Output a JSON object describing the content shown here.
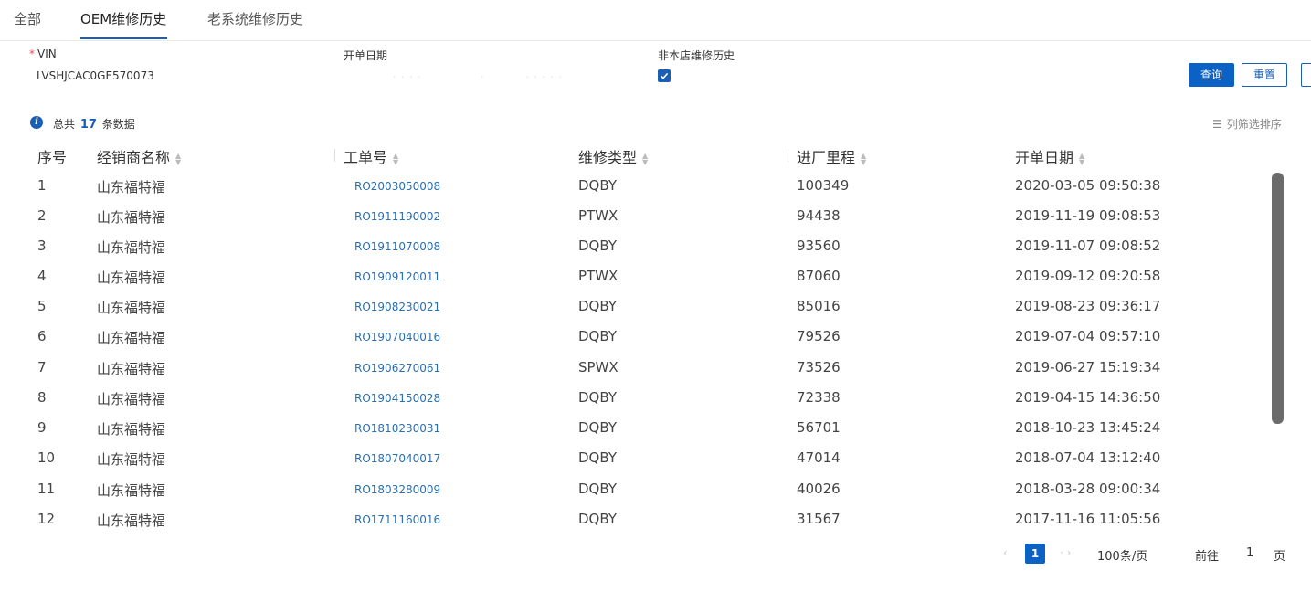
{
  "tabs": [
    {
      "label": "全部"
    },
    {
      "label": "OEM维修历史"
    },
    {
      "label": "老系统维修历史"
    }
  ],
  "form": {
    "vin_label": "VIN",
    "vin_value": "LVSHJCAC0GE570073",
    "date_label": "开单日期",
    "non_store_label": "非本店维修历史",
    "non_store_checked": true
  },
  "buttons": {
    "query": "查询",
    "reset": "重置"
  },
  "summary": {
    "prefix": "总共",
    "count": "17",
    "suffix": "条数据",
    "sort_link": "列筛选排序"
  },
  "table": {
    "headers": [
      "序号",
      "经销商名称",
      "工单号",
      "维修类型",
      "进厂里程",
      "开单日期"
    ],
    "rows": [
      {
        "no": "1",
        "dealer": "山东福特福",
        "ro": "RO2003050008",
        "type": "DQBY",
        "mileage": "100349",
        "date": "2020-03-05 09:50:38"
      },
      {
        "no": "2",
        "dealer": "山东福特福",
        "ro": "RO1911190002",
        "type": "PTWX",
        "mileage": "94438",
        "date": "2019-11-19 09:08:53"
      },
      {
        "no": "3",
        "dealer": "山东福特福",
        "ro": "RO1911070008",
        "type": "DQBY",
        "mileage": "93560",
        "date": "2019-11-07 09:08:52"
      },
      {
        "no": "4",
        "dealer": "山东福特福",
        "ro": "RO1909120011",
        "type": "PTWX",
        "mileage": "87060",
        "date": "2019-09-12 09:20:58"
      },
      {
        "no": "5",
        "dealer": "山东福特福",
        "ro": "RO1908230021",
        "type": "DQBY",
        "mileage": "85016",
        "date": "2019-08-23 09:36:17"
      },
      {
        "no": "6",
        "dealer": "山东福特福",
        "ro": "RO1907040016",
        "type": "DQBY",
        "mileage": "79526",
        "date": "2019-07-04 09:57:10"
      },
      {
        "no": "7",
        "dealer": "山东福特福",
        "ro": "RO1906270061",
        "type": "SPWX",
        "mileage": "73526",
        "date": "2019-06-27 15:19:34"
      },
      {
        "no": "8",
        "dealer": "山东福特福",
        "ro": "RO1904150028",
        "type": "DQBY",
        "mileage": "72338",
        "date": "2019-04-15 14:36:50"
      },
      {
        "no": "9",
        "dealer": "山东福特福",
        "ro": "RO1810230031",
        "type": "DQBY",
        "mileage": "56701",
        "date": "2018-10-23 13:45:24"
      },
      {
        "no": "10",
        "dealer": "山东福特福",
        "ro": "RO1807040017",
        "type": "DQBY",
        "mileage": "47014",
        "date": "2018-07-04 13:12:40"
      },
      {
        "no": "11",
        "dealer": "山东福特福",
        "ro": "RO1803280009",
        "type": "DQBY",
        "mileage": "40026",
        "date": "2018-03-28 09:00:34"
      },
      {
        "no": "12",
        "dealer": "山东福特福",
        "ro": "RO1711160016",
        "type": "DQBY",
        "mileage": "31567",
        "date": "2017-11-16 11:05:56"
      }
    ]
  },
  "pagination": {
    "current_page": "1",
    "page_size": "100条/页",
    "goto_label": "前往",
    "goto_value": "1",
    "page_suffix": "页"
  },
  "colors": {
    "accent": "#0b62c4",
    "link": "#2a6fb0"
  }
}
